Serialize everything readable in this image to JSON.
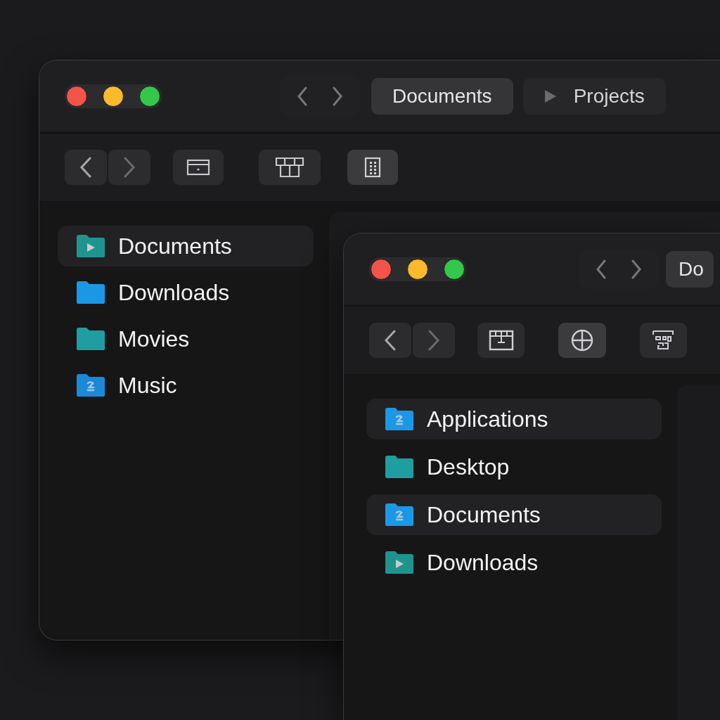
{
  "windows": [
    {
      "tabs": [
        {
          "label": "Documents",
          "selected": true,
          "kind": "plain"
        },
        {
          "label": "Projects",
          "selected": false,
          "kind": "play"
        }
      ],
      "tools": [
        {
          "kind": "tray",
          "selected": false
        },
        {
          "kind": "grid",
          "selected": false
        },
        {
          "kind": "keypad",
          "selected": true
        }
      ],
      "sidebar": [
        {
          "label": "Documents",
          "selected": true,
          "color": "#1f948f",
          "kind": "play"
        },
        {
          "label": "Downloads",
          "selected": false,
          "color": "#1a98e6",
          "kind": "plain"
        },
        {
          "label": "Movies",
          "selected": false,
          "color": "#1f9ea0",
          "kind": "plain"
        },
        {
          "label": "Music",
          "selected": false,
          "color": "#1a8ad8",
          "kind": "app"
        }
      ]
    },
    {
      "tabs": [
        {
          "label": "Do",
          "selected": true,
          "kind": "plain"
        }
      ],
      "tools": [
        {
          "kind": "board",
          "selected": false
        },
        {
          "kind": "crosshair",
          "selected": true
        },
        {
          "kind": "network",
          "selected": false
        }
      ],
      "sidebar": [
        {
          "label": "Applications",
          "selected": true,
          "color": "#1a98e6",
          "kind": "app"
        },
        {
          "label": "Desktop",
          "selected": false,
          "color": "#1f9ea0",
          "kind": "plain"
        },
        {
          "label": "Documents",
          "selected": true,
          "color": "#1a98e6",
          "kind": "app"
        },
        {
          "label": "Downloads",
          "selected": false,
          "color": "#1f948f",
          "kind": "play"
        }
      ]
    }
  ]
}
